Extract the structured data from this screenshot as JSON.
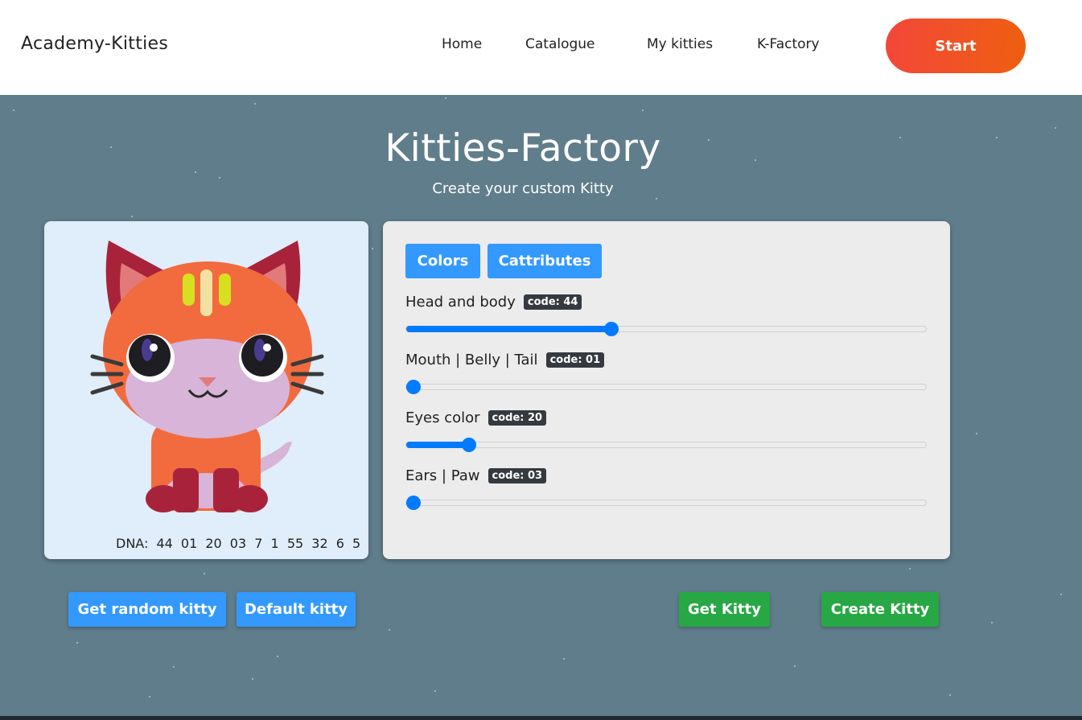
{
  "header": {
    "brand": "Academy-Kitties",
    "nav": [
      "Home",
      "Catalogue",
      "My kitties",
      "K-Factory"
    ],
    "start_label": "Start"
  },
  "hero": {
    "title": "Kitties-Factory",
    "subtitle": "Create your custom Kitty"
  },
  "cat_preview": {
    "dna_label": "DNA:",
    "dna_values": [
      "44",
      "01",
      "20",
      "03",
      "7",
      "1",
      "55",
      "32",
      "6",
      "5"
    ],
    "colors": {
      "head_body": "#f26b3f",
      "mouth_belly_tail": "#d7b4d8",
      "eyes": "#4a3b8f",
      "ears_paw": "#a8233a",
      "inner_ear": "#e27a7a",
      "background": "#e0edfb"
    }
  },
  "controls": {
    "tabs": [
      "Colors",
      "Cattributes"
    ],
    "sliders": [
      {
        "label": "Head and body",
        "code": "code: 44",
        "value": 0.39
      },
      {
        "label": "Mouth | Belly | Tail",
        "code": "code: 01",
        "value": 0.0
      },
      {
        "label": "Eyes color",
        "code": "code: 20",
        "value": 0.11
      },
      {
        "label": "Ears | Paw",
        "code": "code: 03",
        "value": 0.0
      }
    ]
  },
  "actions": {
    "random": "Get random kitty",
    "default": "Default kitty",
    "get": "Get Kitty",
    "create": "Create Kitty"
  }
}
